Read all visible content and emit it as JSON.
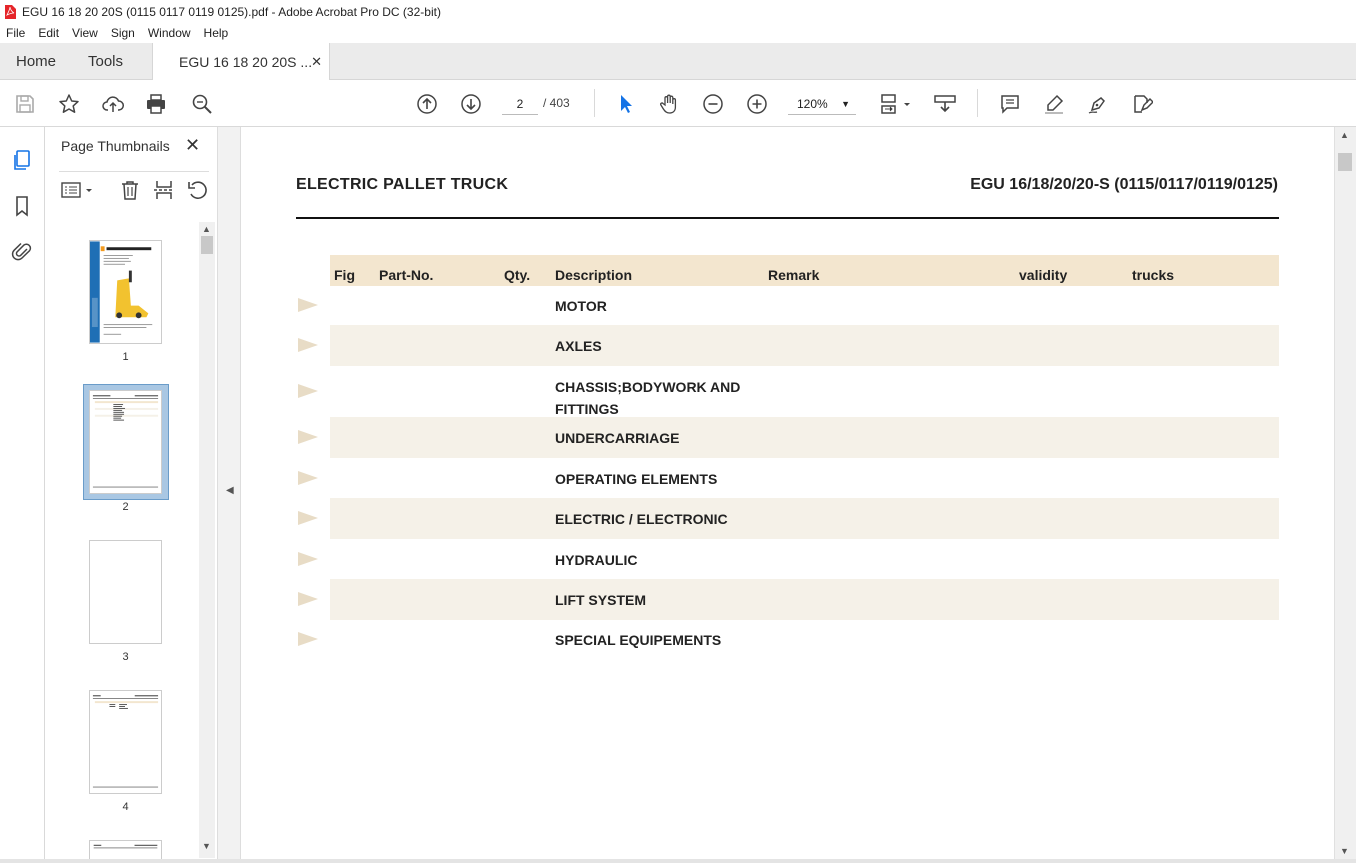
{
  "window": {
    "title": "EGU 16 18 20 20S (0115 0117 0119 0125).pdf - Adobe Acrobat Pro DC (32-bit)"
  },
  "menu": [
    "File",
    "Edit",
    "View",
    "Sign",
    "Window",
    "Help"
  ],
  "tabs": {
    "home": "Home",
    "tools": "Tools",
    "doc": "EGU 16 18 20 20S ..."
  },
  "toolbar": {
    "page_current": "2",
    "page_total": "/ 403",
    "zoom": "120%"
  },
  "thumbnails": {
    "title": "Page Thumbnails",
    "pages": [
      "1",
      "2",
      "3",
      "4"
    ]
  },
  "document": {
    "title": "ELECTRIC PALLET TRUCK",
    "model": "EGU 16/18/20/20-S (0115/0117/0119/0125)",
    "columns": [
      "Fig",
      "Part-No.",
      "Qty.",
      "Description",
      "Remark",
      "validity",
      "trucks"
    ],
    "rows": [
      {
        "desc": "MOTOR"
      },
      {
        "desc": "AXLES"
      },
      {
        "desc": "CHASSIS;BODYWORK AND",
        "desc2": "FITTINGS"
      },
      {
        "desc": "UNDERCARRIAGE"
      },
      {
        "desc": "OPERATING ELEMENTS"
      },
      {
        "desc": "ELECTRIC / ELECTRONIC"
      },
      {
        "desc": "HYDRAULIC"
      },
      {
        "desc": "LIFT SYSTEM"
      },
      {
        "desc": "SPECIAL EQUIPEMENTS"
      }
    ]
  },
  "colors": {
    "header_bg": "#f3e6cf",
    "row_shade": "#f5f1e8",
    "bullet": "#e8dcc6",
    "accent": "#1473e6"
  }
}
